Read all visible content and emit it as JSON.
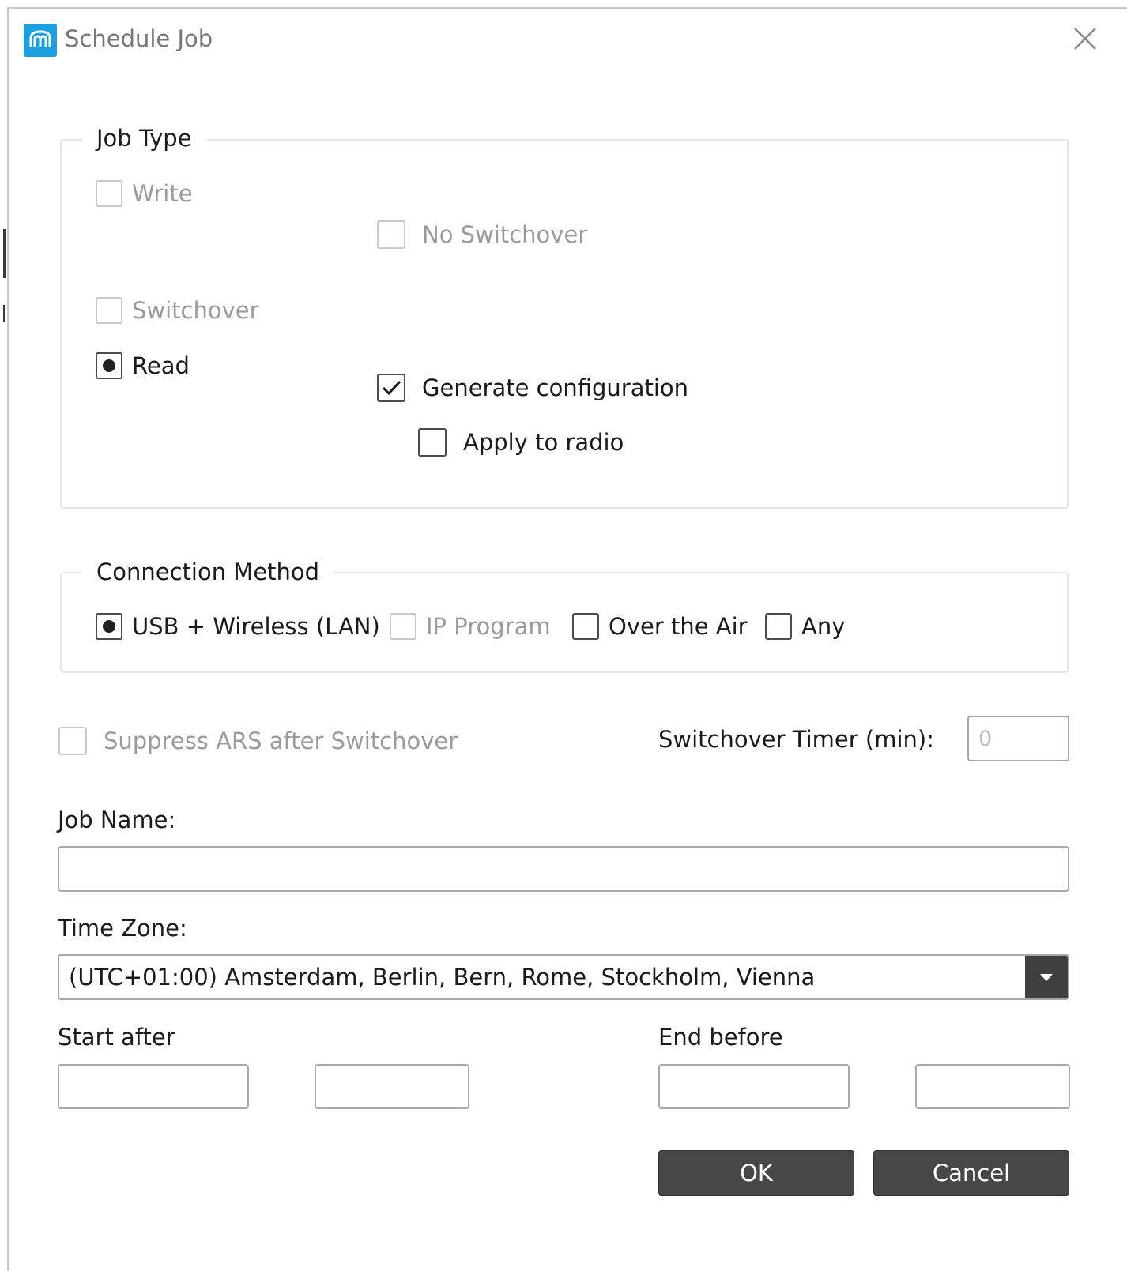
{
  "window": {
    "title": "Schedule Job",
    "app_icon": "mototrbo-logo-icon",
    "close_icon": "close-icon"
  },
  "job_type": {
    "group_label": "Job Type",
    "write": {
      "label": "Write",
      "checked": false,
      "enabled": false
    },
    "no_switchover": {
      "label": "No Switchover",
      "checked": false,
      "enabled": false
    },
    "switchover": {
      "label": "Switchover",
      "checked": false,
      "enabled": false
    },
    "read": {
      "label": "Read",
      "selected": true,
      "enabled": true
    },
    "generate_configuration": {
      "label": "Generate configuration",
      "checked": true,
      "enabled": true
    },
    "apply_to_radio": {
      "label": "Apply to radio",
      "checked": false,
      "enabled": true
    }
  },
  "connection_method": {
    "group_label": "Connection Method",
    "usb_wireless": {
      "label": "USB + Wireless (LAN)",
      "selected": true,
      "enabled": true
    },
    "ip_program": {
      "label": "IP Program",
      "checked": false,
      "enabled": false
    },
    "over_the_air": {
      "label": "Over the Air",
      "checked": false,
      "enabled": true
    },
    "any": {
      "label": "Any",
      "checked": false,
      "enabled": true
    }
  },
  "suppress_ars": {
    "label": "Suppress ARS after Switchover",
    "checked": false,
    "enabled": false
  },
  "switchover_timer": {
    "label": "Switchover Timer (min):",
    "value": "0",
    "enabled": false
  },
  "job_name": {
    "label": "Job Name:",
    "value": ""
  },
  "time_zone": {
    "label": "Time Zone:",
    "selected": "(UTC+01:00) Amsterdam, Berlin, Bern, Rome, Stockholm, Vienna",
    "arrow_icon": "chevron-down-icon"
  },
  "start_after": {
    "label": "Start after",
    "date": "",
    "time": ""
  },
  "end_before": {
    "label": "End before",
    "date": "",
    "time": ""
  },
  "buttons": {
    "ok": "OK",
    "cancel": "Cancel"
  },
  "colors": {
    "accent": "#1a9fe0",
    "button_bg": "#474747",
    "disabled_text": "#9b9b9b",
    "group_border": "#e3e6ea"
  }
}
